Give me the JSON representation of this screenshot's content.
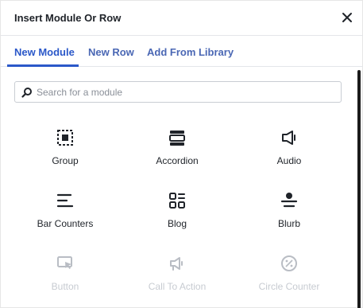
{
  "dialog": {
    "title": "Insert Module Or Row",
    "close_icon": "close-icon"
  },
  "tabs": [
    {
      "label": "New Module",
      "active": true
    },
    {
      "label": "New Row",
      "active": false
    },
    {
      "label": "Add From Library",
      "active": false
    }
  ],
  "search": {
    "placeholder": "Search for a module",
    "value": ""
  },
  "modules": [
    {
      "label": "Group",
      "icon": "group-icon"
    },
    {
      "label": "Accordion",
      "icon": "accordion-icon"
    },
    {
      "label": "Audio",
      "icon": "audio-icon"
    },
    {
      "label": "Bar Counters",
      "icon": "bar-counters-icon"
    },
    {
      "label": "Blog",
      "icon": "blog-icon"
    },
    {
      "label": "Blurb",
      "icon": "blurb-icon"
    },
    {
      "label": "Button",
      "icon": "button-icon"
    },
    {
      "label": "Call To Action",
      "icon": "call-to-action-icon"
    },
    {
      "label": "Circle Counter",
      "icon": "circle-counter-icon"
    }
  ],
  "colors": {
    "accent": "#2b58c9",
    "text": "#1f2329",
    "faded_text": "#c7cbd1"
  }
}
